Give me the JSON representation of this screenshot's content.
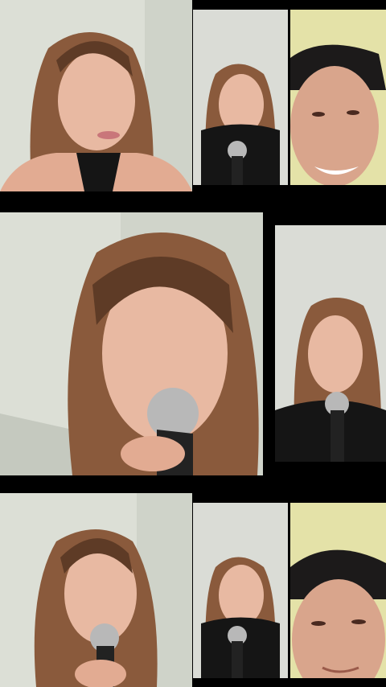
{
  "collage": {
    "background": "#000000",
    "frames": [
      {
        "subject": "woman-close-up",
        "has_mic": false
      },
      {
        "subject": "woman-with-mic",
        "has_mic": true
      },
      {
        "subject": "man-smiling",
        "has_mic": false
      },
      {
        "subject": "woman-singing-large",
        "has_mic": true
      },
      {
        "subject": "woman-with-mic",
        "has_mic": true
      },
      {
        "subject": "woman-singing",
        "has_mic": true
      },
      {
        "subject": "woman-with-mic",
        "has_mic": true
      },
      {
        "subject": "man-close-up",
        "has_mic": false
      }
    ]
  },
  "palette": {
    "wall": "#dcdfd6",
    "wall_shadow": "#c5c9bf",
    "hair": "#8a5a3c",
    "hair_dark": "#5e3b26",
    "skin": "#e8b9a2",
    "lips": "#c9767a",
    "mic_head": "#b8b8b8",
    "mic_body": "#222222",
    "top_black": "#151515",
    "man_skin": "#d9a58c",
    "man_hair": "#1c1a1a"
  }
}
